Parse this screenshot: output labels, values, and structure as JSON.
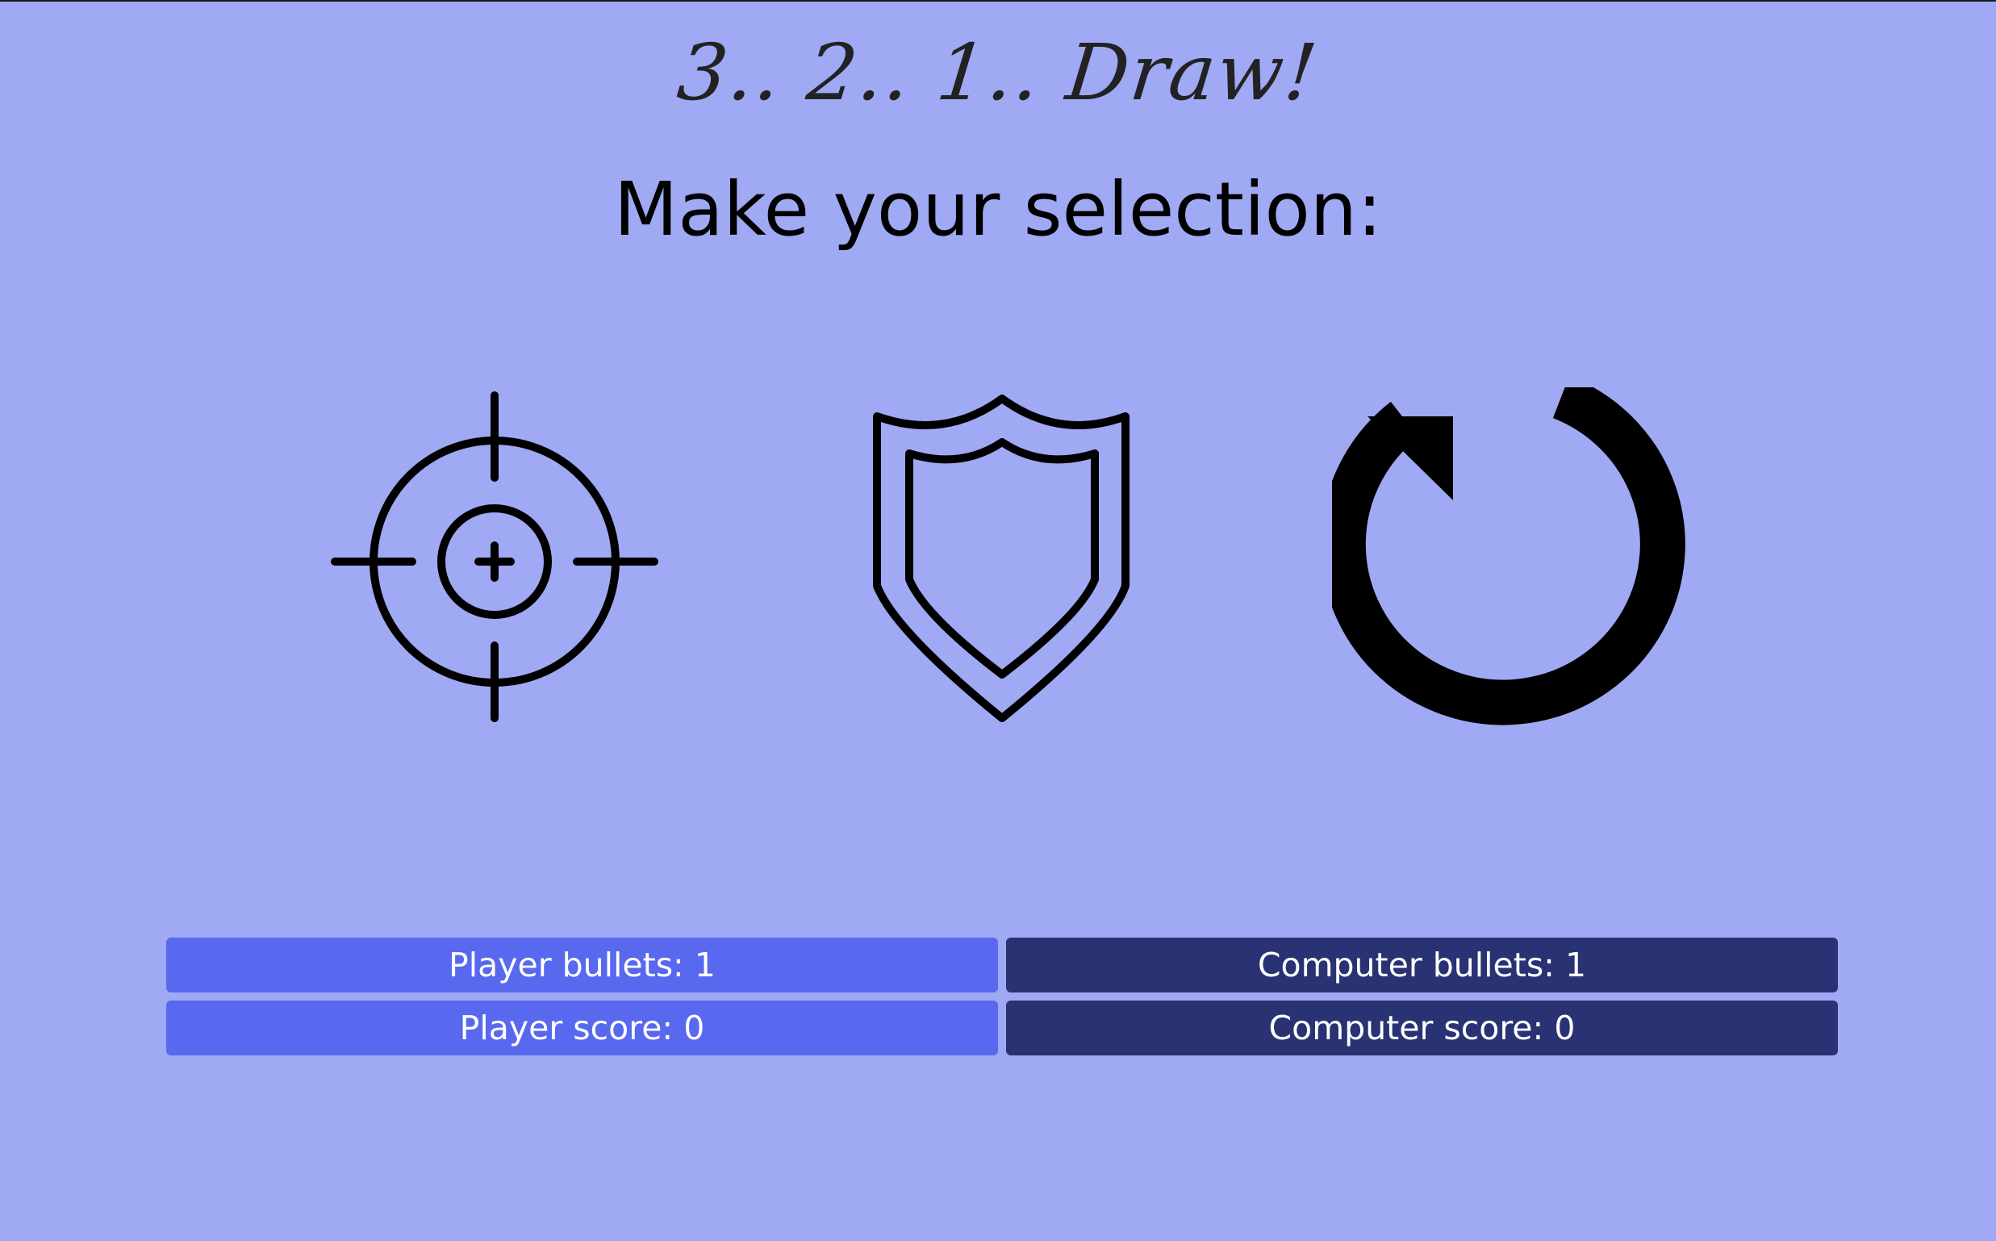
{
  "header": {
    "logo_text": "3.. 2.. 1.. Draw!"
  },
  "main": {
    "prompt": "Make your selection:",
    "choices": [
      {
        "icon": "crosshair-icon"
      },
      {
        "icon": "shield-icon"
      },
      {
        "icon": "reload-icon"
      }
    ]
  },
  "stats": {
    "player_bullets": "Player bullets: 1",
    "computer_bullets": "Computer bullets: 1",
    "player_score": "Player score: 0",
    "computer_score": "Computer score: 0"
  },
  "colors": {
    "background": "#a0a9f4",
    "player_panel": "#5868ef",
    "computer_panel": "#293272",
    "text_light": "#ffffff",
    "icon_stroke": "#000000"
  }
}
